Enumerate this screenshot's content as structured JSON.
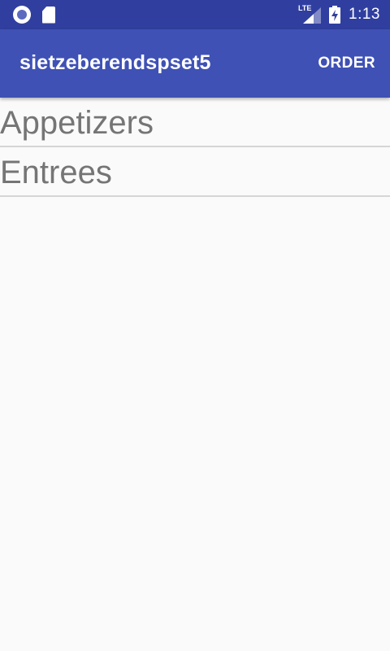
{
  "status_bar": {
    "network_type": "LTE",
    "time": "1:13",
    "icons": [
      "sync-icon",
      "sd-card-icon",
      "signal-icon",
      "battery-charging-icon"
    ]
  },
  "app_bar": {
    "title": "sietzeberendspset5",
    "order_label": "ORDER"
  },
  "colors": {
    "status_bar": "#303f9f",
    "app_bar": "#3f51b5",
    "background": "#fafafa",
    "list_text": "#757575",
    "divider": "#d6d6d6"
  },
  "menu": {
    "items": [
      {
        "label": "Appetizers"
      },
      {
        "label": "Entrees"
      }
    ]
  }
}
